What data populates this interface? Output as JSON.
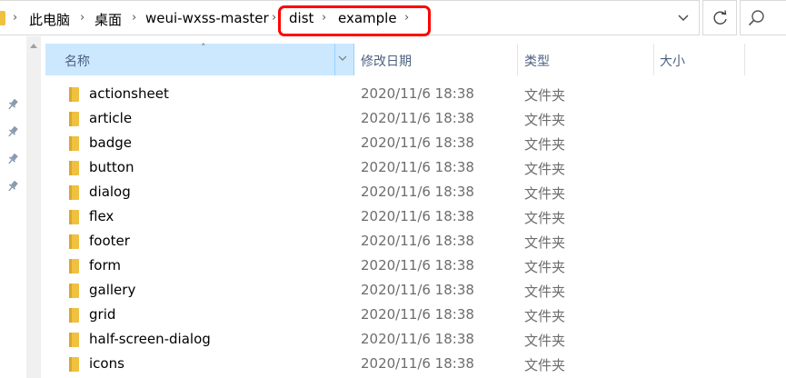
{
  "breadcrumbs": [
    "此电脑",
    "桌面",
    "weui-wxss-master",
    "dist",
    "example"
  ],
  "columns": {
    "name": "名称",
    "date_modified": "修改日期",
    "type": "类型",
    "size": "大小"
  },
  "files": [
    {
      "name": "actionsheet",
      "date": "2020/11/6 18:38",
      "type": "文件夹"
    },
    {
      "name": "article",
      "date": "2020/11/6 18:38",
      "type": "文件夹"
    },
    {
      "name": "badge",
      "date": "2020/11/6 18:38",
      "type": "文件夹"
    },
    {
      "name": "button",
      "date": "2020/11/6 18:38",
      "type": "文件夹"
    },
    {
      "name": "dialog",
      "date": "2020/11/6 18:38",
      "type": "文件夹"
    },
    {
      "name": "flex",
      "date": "2020/11/6 18:38",
      "type": "文件夹"
    },
    {
      "name": "footer",
      "date": "2020/11/6 18:38",
      "type": "文件夹"
    },
    {
      "name": "form",
      "date": "2020/11/6 18:38",
      "type": "文件夹"
    },
    {
      "name": "gallery",
      "date": "2020/11/6 18:38",
      "type": "文件夹"
    },
    {
      "name": "grid",
      "date": "2020/11/6 18:38",
      "type": "文件夹"
    },
    {
      "name": "half-screen-dialog",
      "date": "2020/11/6 18:38",
      "type": "文件夹"
    },
    {
      "name": "icons",
      "date": "2020/11/6 18:38",
      "type": "文件夹"
    }
  ],
  "icons": {
    "folder": "folder-icon",
    "pin": "pin-icon",
    "refresh": "refresh-icon",
    "search": "search-icon",
    "chevron": "chevron-down-icon"
  },
  "colors": {
    "highlight": "#ff0000",
    "header_selected": "#cce8ff",
    "folder": "#f0c040",
    "meta_text": "#6d6d6d"
  }
}
